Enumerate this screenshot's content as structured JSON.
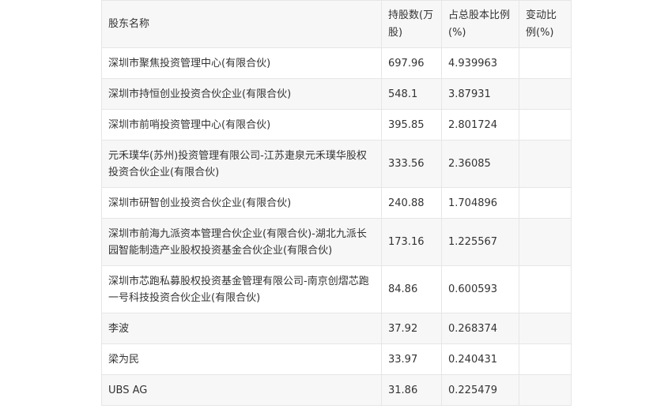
{
  "table": {
    "headers": {
      "name": "股东名称",
      "shares": "持股数(万股)",
      "pct": "占总股本比例(%)",
      "change": "变动比例(%)"
    },
    "rows": [
      {
        "name": "深圳市聚焦投资管理中心(有限合伙)",
        "shares": "697.96",
        "pct": "4.939963",
        "change": ""
      },
      {
        "name": "深圳市持恒创业投资合伙企业(有限合伙)",
        "shares": "548.1",
        "pct": "3.87931",
        "change": ""
      },
      {
        "name": "深圳市前哨投资管理中心(有限合伙)",
        "shares": "395.85",
        "pct": "2.801724",
        "change": ""
      },
      {
        "name": "元禾璞华(苏州)投资管理有限公司-江苏疌泉元禾璞华股权投资合伙企业(有限合伙)",
        "shares": "333.56",
        "pct": "2.36085",
        "change": ""
      },
      {
        "name": "深圳市研智创业投资合伙企业(有限合伙)",
        "shares": "240.88",
        "pct": "1.704896",
        "change": ""
      },
      {
        "name": "深圳市前海九派资本管理合伙企业(有限合伙)-湖北九派长园智能制造产业股权投资基金合伙企业(有限合伙)",
        "shares": "173.16",
        "pct": "1.225567",
        "change": ""
      },
      {
        "name": "深圳市芯跑私募股权投资基金管理有限公司-南京创熠芯跑一号科技投资合伙企业(有限合伙)",
        "shares": "84.86",
        "pct": "0.600593",
        "change": ""
      },
      {
        "name": "李波",
        "shares": "37.92",
        "pct": "0.268374",
        "change": ""
      },
      {
        "name": "梁为民",
        "shares": "33.97",
        "pct": "0.240431",
        "change": ""
      },
      {
        "name": "UBS AG",
        "shares": "31.86",
        "pct": "0.225479",
        "change": ""
      }
    ]
  }
}
